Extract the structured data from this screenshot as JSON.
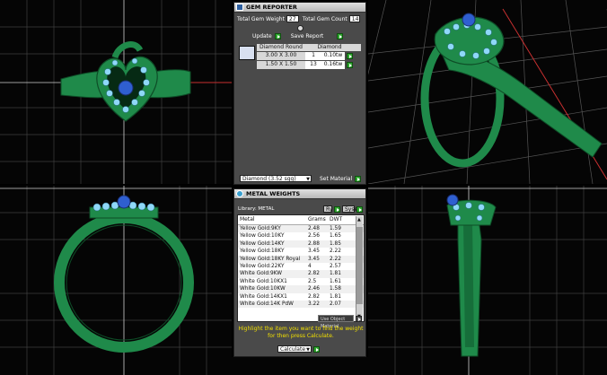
{
  "gem_reporter": {
    "title": "GEM REPORTER",
    "total_weight_label": "Total Gem Weight",
    "total_weight_value": "27",
    "total_count_label": "Total Gem Count",
    "total_count_value": "14",
    "update_label": "Update",
    "save_report_label": "Save Report",
    "table_headers": [
      "Diamond Round",
      "Diamond"
    ],
    "rows": [
      {
        "size": "3.00 X 3.00",
        "count": "1",
        "weight": "0.10tw"
      },
      {
        "size": "1.50 X 1.50",
        "count": "13",
        "weight": "0.16tw"
      }
    ],
    "material_select": "Diamond     (3.52 sgg)",
    "set_material_label": "Set Material"
  },
  "metal_weights": {
    "title": "METAL WEIGHTS",
    "library_label": "Library: METAL",
    "btn_left": "Ry",
    "btn_right": "Syse",
    "headers": [
      "Metal",
      "Grams",
      "DWT"
    ],
    "rows": [
      [
        "Yellow Gold:9KY",
        "2.48",
        "1.59"
      ],
      [
        "Yellow Gold:10KY",
        "2.56",
        "1.65"
      ],
      [
        "Yellow Gold:14KY",
        "2.88",
        "1.85"
      ],
      [
        "Yellow Gold:18KY",
        "3.45",
        "2.22"
      ],
      [
        "Yellow Gold:18KY Royal",
        "3.45",
        "2.22"
      ],
      [
        "Yellow Gold:22KY",
        "4",
        "2.57"
      ],
      [
        "White Gold:9KW",
        "2.82",
        "1.81"
      ],
      [
        "White Gold:10KX1",
        "2.5",
        "1.61"
      ],
      [
        "White Gold:10KW",
        "2.46",
        "1.58"
      ],
      [
        "White Gold:14KX1",
        "2.82",
        "1.81"
      ],
      [
        "White Gold:14K PdW",
        "3.22",
        "2.07"
      ]
    ],
    "use_object_label": "Use Object Material",
    "hint": "Highlight the item you want to find the weight for then press Calculate.",
    "calculate_label": "Calculate"
  },
  "colors": {
    "ring_green": "#1f8a4a",
    "gem_blue": "#8fd8f8",
    "grid": "#5a5a5a",
    "hint_yellow": "#f2e000"
  }
}
